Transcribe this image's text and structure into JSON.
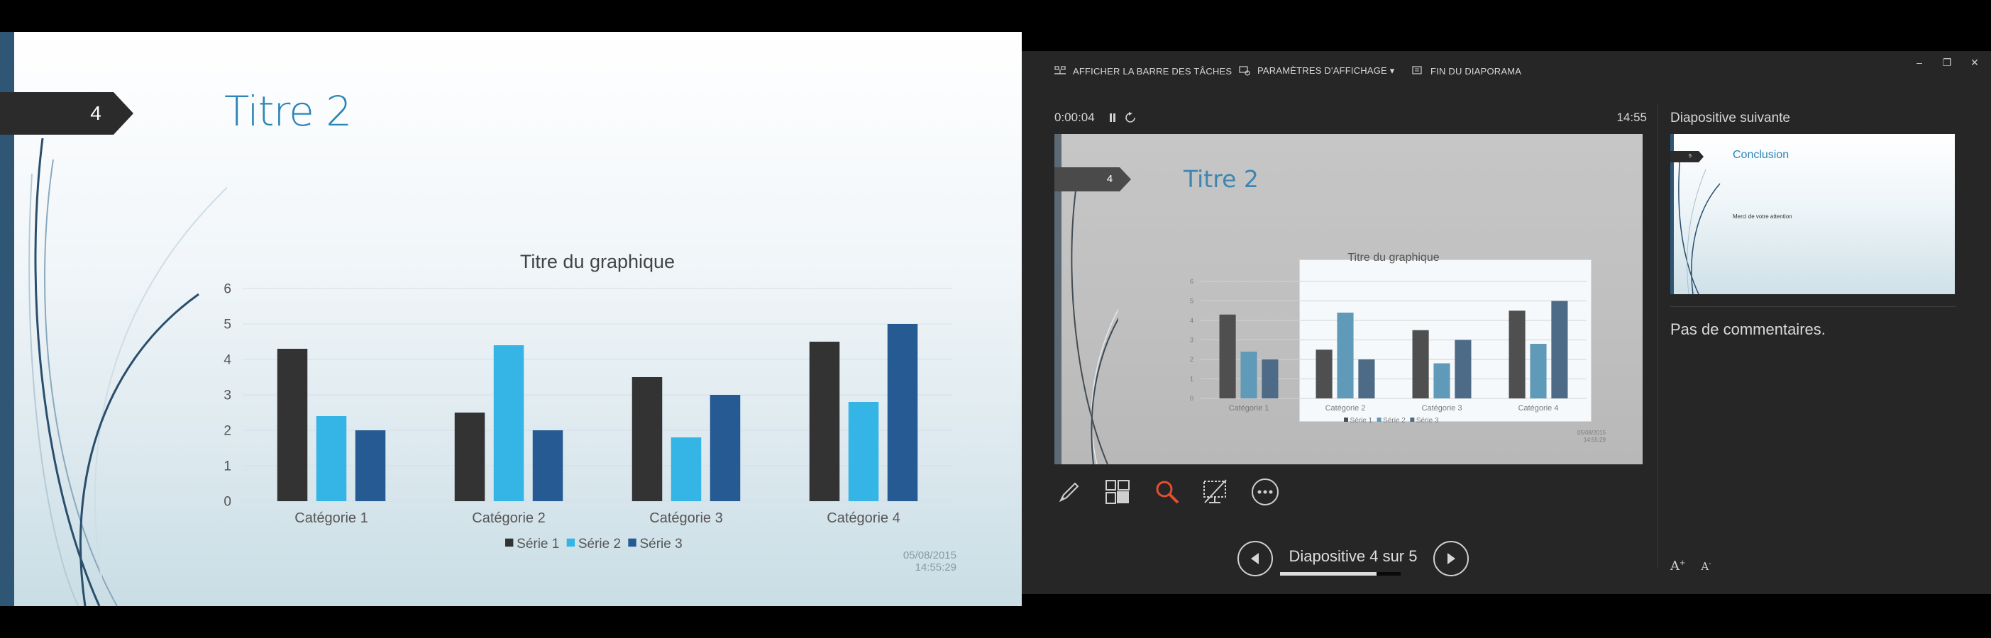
{
  "audience": {
    "slide_number": "4",
    "title": "Titre 2",
    "date": "05/08/2015",
    "time": "14:55:29"
  },
  "chart_data": {
    "type": "bar",
    "title": "Titre du graphique",
    "categories": [
      "Catégorie 1",
      "Catégorie 2",
      "Catégorie 3",
      "Catégorie 4"
    ],
    "series": [
      {
        "name": "Série 1",
        "values": [
          4.3,
          2.5,
          3.5,
          4.5
        ],
        "color": "#333333"
      },
      {
        "name": "Série 2",
        "values": [
          2.4,
          4.4,
          1.8,
          2.8
        ],
        "color": "#35b5e5"
      },
      {
        "name": "Série 3",
        "values": [
          2,
          2,
          3,
          5
        ],
        "color": "#255a92"
      }
    ],
    "ylim": [
      0,
      6
    ],
    "yticks": [
      "0",
      "1",
      "2",
      "3",
      "4",
      "5",
      "6"
    ],
    "grid": true,
    "legend": "bottom"
  },
  "presenter": {
    "toolbar": {
      "taskbar_label": "AFFICHER LA BARRE DES TÂCHES",
      "display_settings_label": "PARAMÈTRES D'AFFICHAGE ▾",
      "end_show_label": "FIN DU DIAPORAMA"
    },
    "window_controls": {
      "minimize": "–",
      "restore": "❐",
      "close": "✕"
    },
    "timer": "0:00:04",
    "clock": "14:55",
    "current_preview": {
      "slide_number": "4",
      "title": "Titre 2",
      "date": "05/08/2015",
      "time": "14:55:29"
    },
    "tools": [
      "pen-icon",
      "see-all-slides-icon",
      "zoom-icon",
      "black-screen-icon",
      "more-options-icon"
    ],
    "slide_counter": "Diapositive 4 sur 5",
    "progress": 0.8,
    "next_slide_label": "Diapositive suivante",
    "next_slide": {
      "slide_number": "5",
      "title": "Conclusion",
      "body": "Merci de votre attention"
    },
    "notes": "Pas de commentaires.",
    "font_increase": "A",
    "font_decrease": "A",
    "accent": "#e0502e"
  }
}
